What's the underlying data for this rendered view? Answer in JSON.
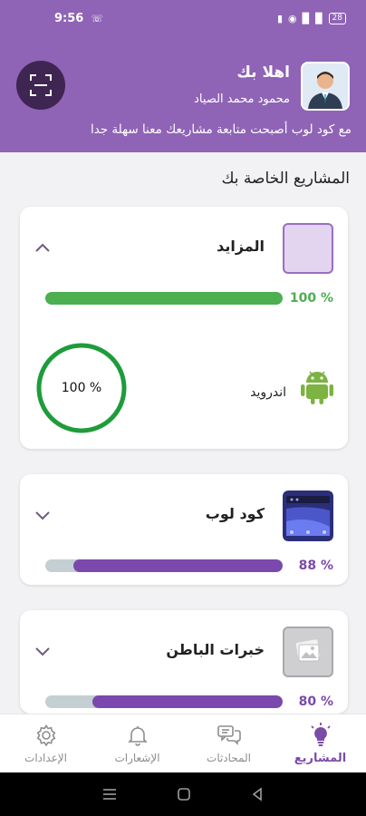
{
  "status_bar": {
    "time": "9:56",
    "battery": "28"
  },
  "header": {
    "greeting": "اهلا بك",
    "user_name": "محمود محمد الصياد",
    "tagline": "مع كود لوب أصبحت متابعة مشاريعك معنا سهلة جدا"
  },
  "section_title": "المشاريع الخاصة بك",
  "projects": [
    {
      "name": "المزايد",
      "progress_label": "100 %",
      "progress": 100,
      "color": "#4caf50",
      "expanded": true,
      "platform": {
        "name": "اندرويد",
        "progress_label": "100 %",
        "progress": 100
      }
    },
    {
      "name": "كود لوب",
      "progress_label": "88 %",
      "progress": 88,
      "color": "#7b48ad",
      "expanded": false
    },
    {
      "name": "خبرات الباطن",
      "progress_label": "80 %",
      "progress": 80,
      "color": "#7b48ad",
      "expanded": false
    }
  ],
  "bottom_nav": [
    {
      "label": "المشاريع",
      "icon": "lightbulb-icon",
      "active": true
    },
    {
      "label": "المحادثات",
      "icon": "chat-icon",
      "active": false
    },
    {
      "label": "الإشعارات",
      "icon": "bell-icon",
      "active": false
    },
    {
      "label": "الإعدادات",
      "icon": "gear-icon",
      "active": false
    }
  ],
  "colors": {
    "primary": "#8f63b5",
    "dark_primary": "#3f2551",
    "success": "#4caf50",
    "progress": "#7b48ad",
    "track": "#c3cfd3"
  }
}
